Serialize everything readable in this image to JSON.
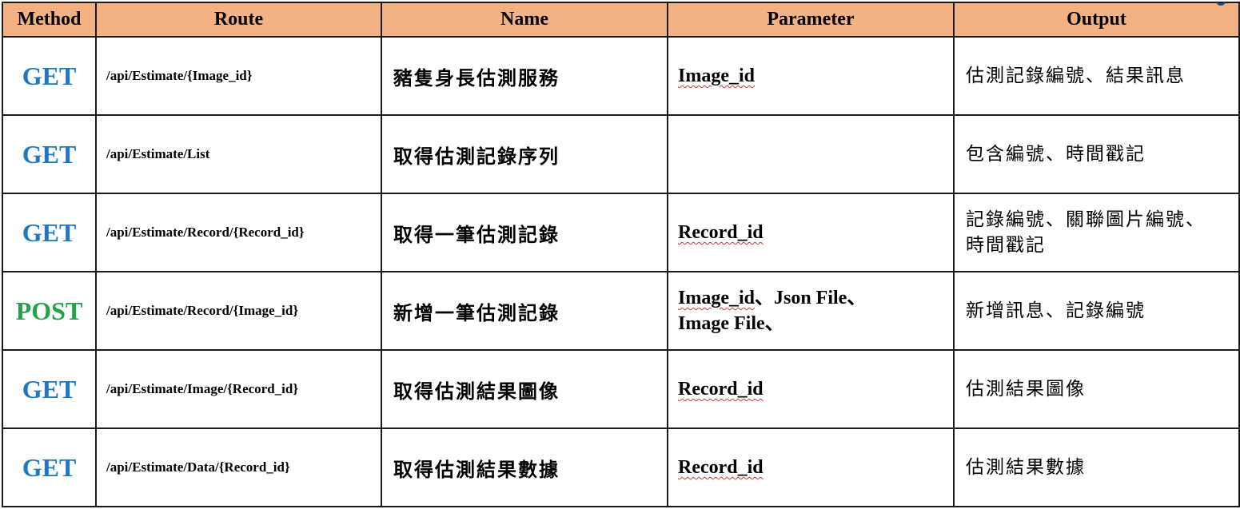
{
  "colors": {
    "header_bg": "#f4b183",
    "get": "#1f78c1",
    "post": "#22a34a"
  },
  "header": {
    "method": "Method",
    "route": "Route",
    "name": "Name",
    "parameter": "Parameter",
    "output": "Output"
  },
  "rows": [
    {
      "method": "GET",
      "route": "/api/Estimate/{Image_id}",
      "name": "豬隻身長估測服務",
      "parameter": [
        "Image_id"
      ],
      "output": [
        "估測記錄編號、結果訊息"
      ]
    },
    {
      "method": "GET",
      "route": "/api/Estimate/List",
      "name": "取得估測記錄序列",
      "parameter": [],
      "output": [
        "包含編號、時間戳記"
      ]
    },
    {
      "method": "GET",
      "route": "/api/Estimate/Record/{Record_id}",
      "name": "取得一筆估測記錄",
      "parameter": [
        "Record_id"
      ],
      "output": [
        "記錄編號、關聯圖片編號、",
        "時間戳記"
      ]
    },
    {
      "method": "POST",
      "route": "/api/Estimate/Record/{Image_id}",
      "name": "新增一筆估測記錄",
      "parameter": [
        "Image_id、Json File、",
        "Image File、"
      ],
      "output": [
        "新增訊息、記錄編號"
      ]
    },
    {
      "method": "GET",
      "route": "/api/Estimate/Image/{Record_id}",
      "name": "取得估測結果圖像",
      "parameter": [
        "Record_id"
      ],
      "output": [
        "估測結果圖像"
      ]
    },
    {
      "method": "GET",
      "route": "/api/Estimate/Data/{Record_id}",
      "name": "取得估測結果數據",
      "parameter": [
        "Record_id"
      ],
      "output": [
        "估測結果數據"
      ]
    }
  ]
}
